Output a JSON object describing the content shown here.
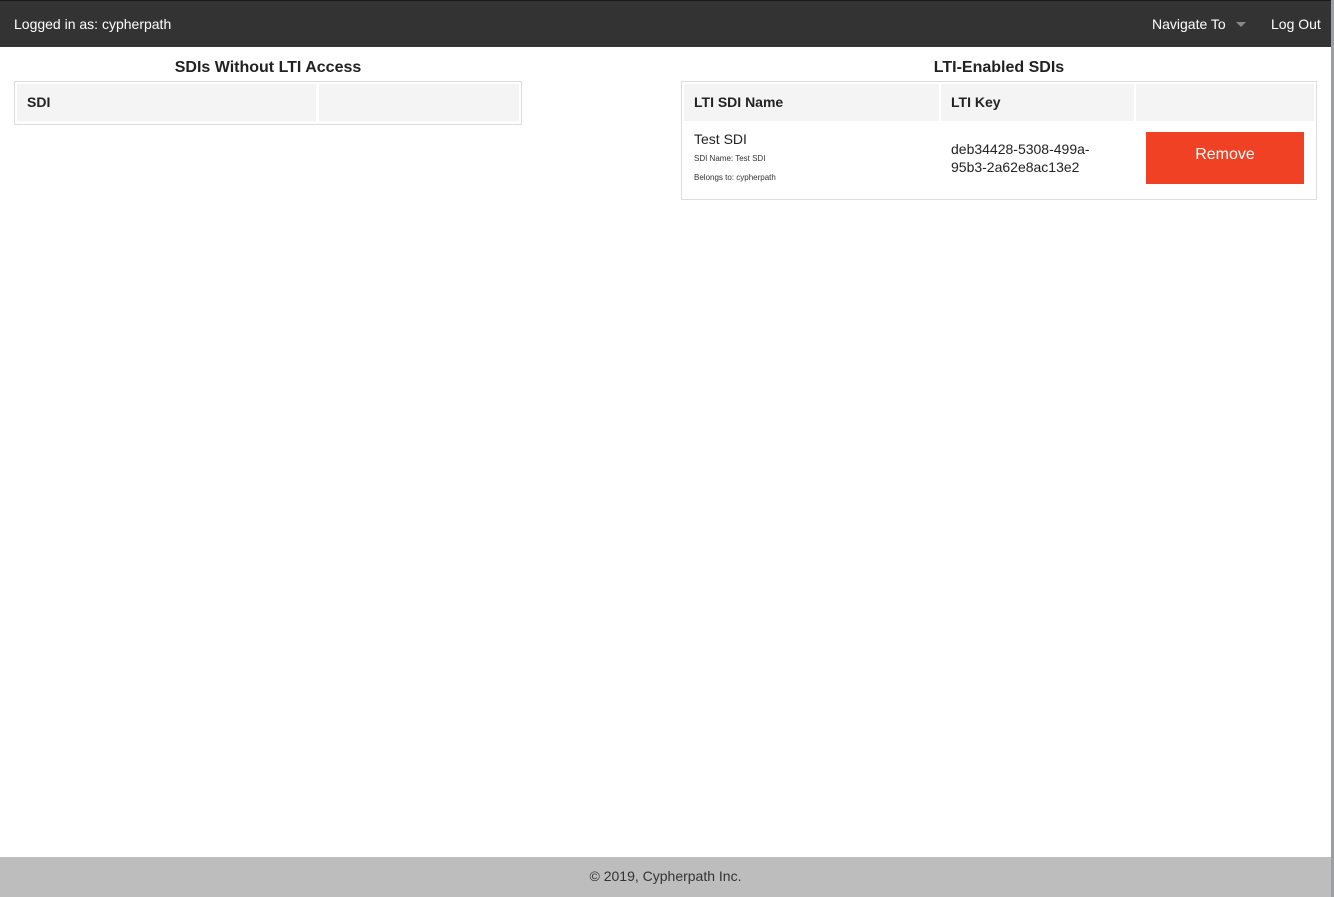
{
  "header": {
    "logged_in_label": "Logged in as: cypherpath",
    "navigate_label": "Navigate To",
    "logout_label": "Log Out"
  },
  "left_panel": {
    "title": "SDIs Without LTI Access",
    "columns": [
      "SDI",
      ""
    ],
    "rows": []
  },
  "right_panel": {
    "title": "LTI-Enabled SDIs",
    "columns": [
      "LTI SDI Name",
      "LTI Key",
      ""
    ],
    "rows": [
      {
        "name": "Test SDI",
        "sdi_name": "SDI Name: Test SDI",
        "belongs_to": "Belongs to: cypherpath",
        "key_line1": "deb34428-5308-499a-",
        "key_line2": "95b3-2a62e8ac13e2",
        "action_label": "Remove"
      }
    ]
  },
  "footer": {
    "copyright": "© 2019, Cypherpath Inc."
  },
  "colors": {
    "topbar": "#333333",
    "remove_button": "#f04124",
    "footer": "#bdbdbd",
    "header_cell": "#f4f4f4"
  }
}
